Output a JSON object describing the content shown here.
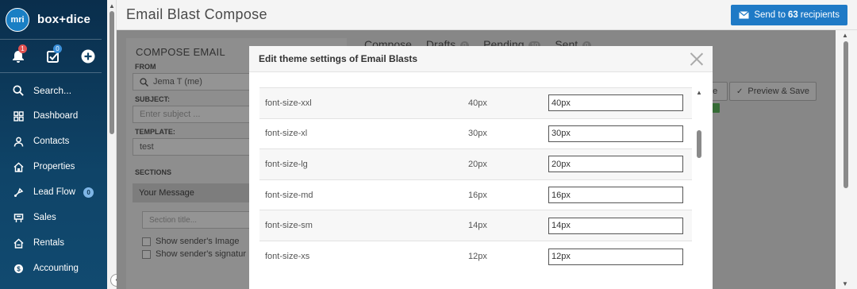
{
  "app": {
    "logo_text": "mri",
    "brand_name": "box+dice"
  },
  "quick_actions": {
    "notifications_count": "1",
    "tasks_count": "0"
  },
  "sidebar": {
    "items": [
      {
        "label": "Search..."
      },
      {
        "label": "Dashboard"
      },
      {
        "label": "Contacts"
      },
      {
        "label": "Properties"
      },
      {
        "label": "Lead Flow",
        "badge": "0"
      },
      {
        "label": "Sales"
      },
      {
        "label": "Rentals"
      },
      {
        "label": "Accounting"
      }
    ]
  },
  "header": {
    "page_title": "Email Blast Compose",
    "send_prefix": "Send to",
    "send_count": "63",
    "send_suffix": "recipients"
  },
  "compose": {
    "title": "COMPOSE EMAIL",
    "from_label": "FROM",
    "from_value": "Jema T (me)",
    "subject_label": "SUBJECT:",
    "subject_placeholder": "Enter subject ...",
    "template_label": "TEMPLATE:",
    "template_value": "test",
    "sections_label": "SECTIONS",
    "section_name": "Your Message",
    "section_title_placeholder": "Section title...",
    "show_image_label": "Show sender's Image",
    "show_signature_label": "Show sender's signatur"
  },
  "tabs": [
    {
      "label": "Compose"
    },
    {
      "label": "Drafts",
      "badge": "0"
    },
    {
      "label": "Pending",
      "badge": "10"
    },
    {
      "label": "Sent",
      "badge": "0"
    }
  ],
  "right_panel": {
    "theme_label": "he",
    "preview_label": "Preview & Save"
  },
  "modal": {
    "title": "Edit theme settings of Email Blasts",
    "rows": [
      {
        "key": "font-size-xxl",
        "default": "40px",
        "value": "40px"
      },
      {
        "key": "font-size-xl",
        "default": "30px",
        "value": "30px"
      },
      {
        "key": "font-size-lg",
        "default": "20px",
        "value": "20px"
      },
      {
        "key": "font-size-md",
        "default": "16px",
        "value": "16px"
      },
      {
        "key": "font-size-sm",
        "default": "14px",
        "value": "14px"
      },
      {
        "key": "font-size-xs",
        "default": "12px",
        "value": "12px"
      }
    ]
  },
  "colors": {
    "sidebar": "#0f4468",
    "accent": "#1f7ac6",
    "badge_red": "#e05252",
    "badge_blue": "#3a8fd9"
  }
}
